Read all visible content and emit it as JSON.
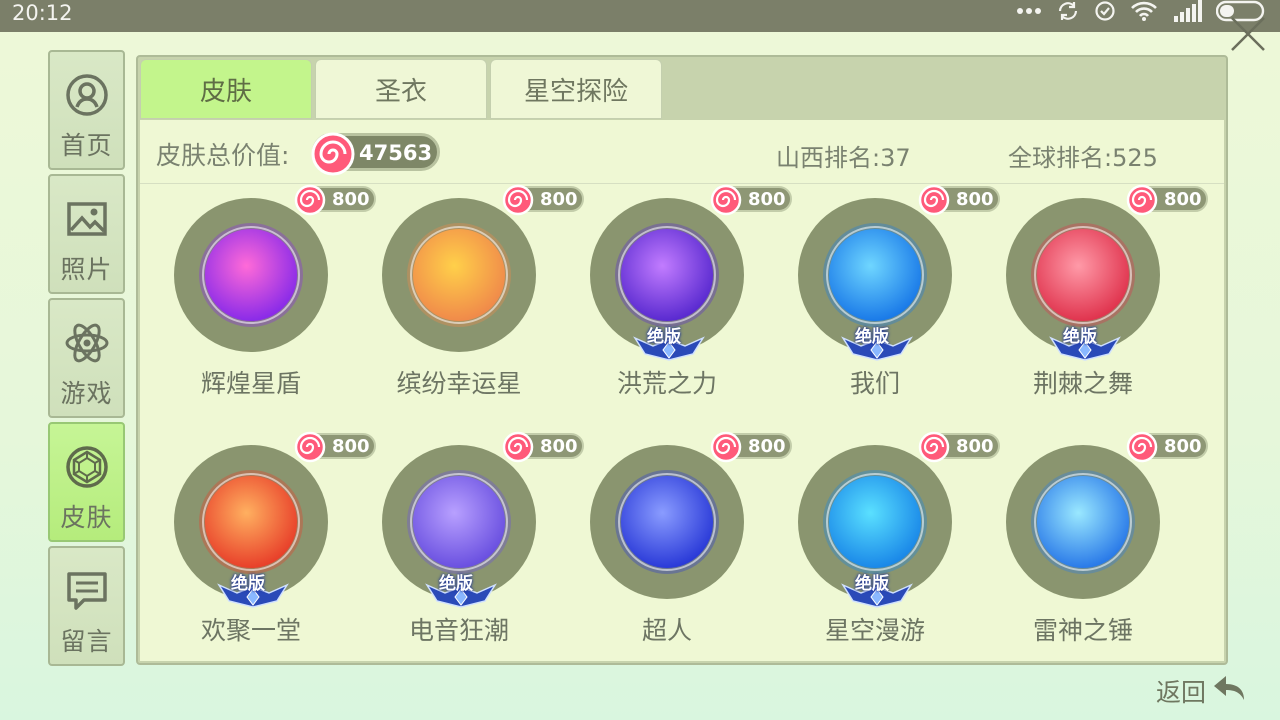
{
  "status_bar": {
    "time": "20:12"
  },
  "sidebar": {
    "items": [
      {
        "label": "首页",
        "icon": "user-circle-icon",
        "active": false
      },
      {
        "label": "照片",
        "icon": "photo-icon",
        "active": false
      },
      {
        "label": "游戏",
        "icon": "atom-icon",
        "active": false
      },
      {
        "label": "皮肤",
        "icon": "gem-circle-icon",
        "active": true
      },
      {
        "label": "留言",
        "icon": "message-icon",
        "active": false
      }
    ]
  },
  "tabs": [
    {
      "label": "皮肤",
      "active": true
    },
    {
      "label": "圣衣",
      "active": false
    },
    {
      "label": "星空探险",
      "active": false
    }
  ],
  "summary": {
    "total_label": "皮肤总价值:",
    "total_value": "47563",
    "province_rank": "山西排名:37",
    "global_rank": "全球排名:525"
  },
  "skins": [
    {
      "name": "辉煌星盾",
      "price": "800",
      "badge": "",
      "colors": [
        "#ff6ad8",
        "#8a2be8"
      ]
    },
    {
      "name": "缤纷幸运星",
      "price": "800",
      "badge": "",
      "colors": [
        "#ffd04a",
        "#f08a4a"
      ]
    },
    {
      "name": "洪荒之力",
      "price": "800",
      "badge": "绝版",
      "colors": [
        "#c27cff",
        "#5a2ad0"
      ]
    },
    {
      "name": "我们",
      "price": "800",
      "badge": "绝版",
      "colors": [
        "#6fd6ff",
        "#1a7ae8"
      ]
    },
    {
      "name": "荆棘之舞",
      "price": "800",
      "badge": "绝版",
      "colors": [
        "#ff9aa8",
        "#e0344e"
      ]
    },
    {
      "name": "欢聚一堂",
      "price": "800",
      "badge": "绝版",
      "colors": [
        "#ffb060",
        "#e8402a"
      ]
    },
    {
      "name": "电音狂潮",
      "price": "800",
      "badge": "绝版",
      "colors": [
        "#b8a0ff",
        "#6a50e0"
      ]
    },
    {
      "name": "超人",
      "price": "800",
      "badge": "",
      "colors": [
        "#8a9cff",
        "#2a3ad8"
      ]
    },
    {
      "name": "星空漫游",
      "price": "800",
      "badge": "绝版",
      "colors": [
        "#5ae0ff",
        "#1a88e8"
      ]
    },
    {
      "name": "雷神之锤",
      "price": "800",
      "badge": "",
      "colors": [
        "#9ae8ff",
        "#2a7ae8"
      ]
    }
  ],
  "back_label": "返回",
  "accent": "#c3f58c"
}
